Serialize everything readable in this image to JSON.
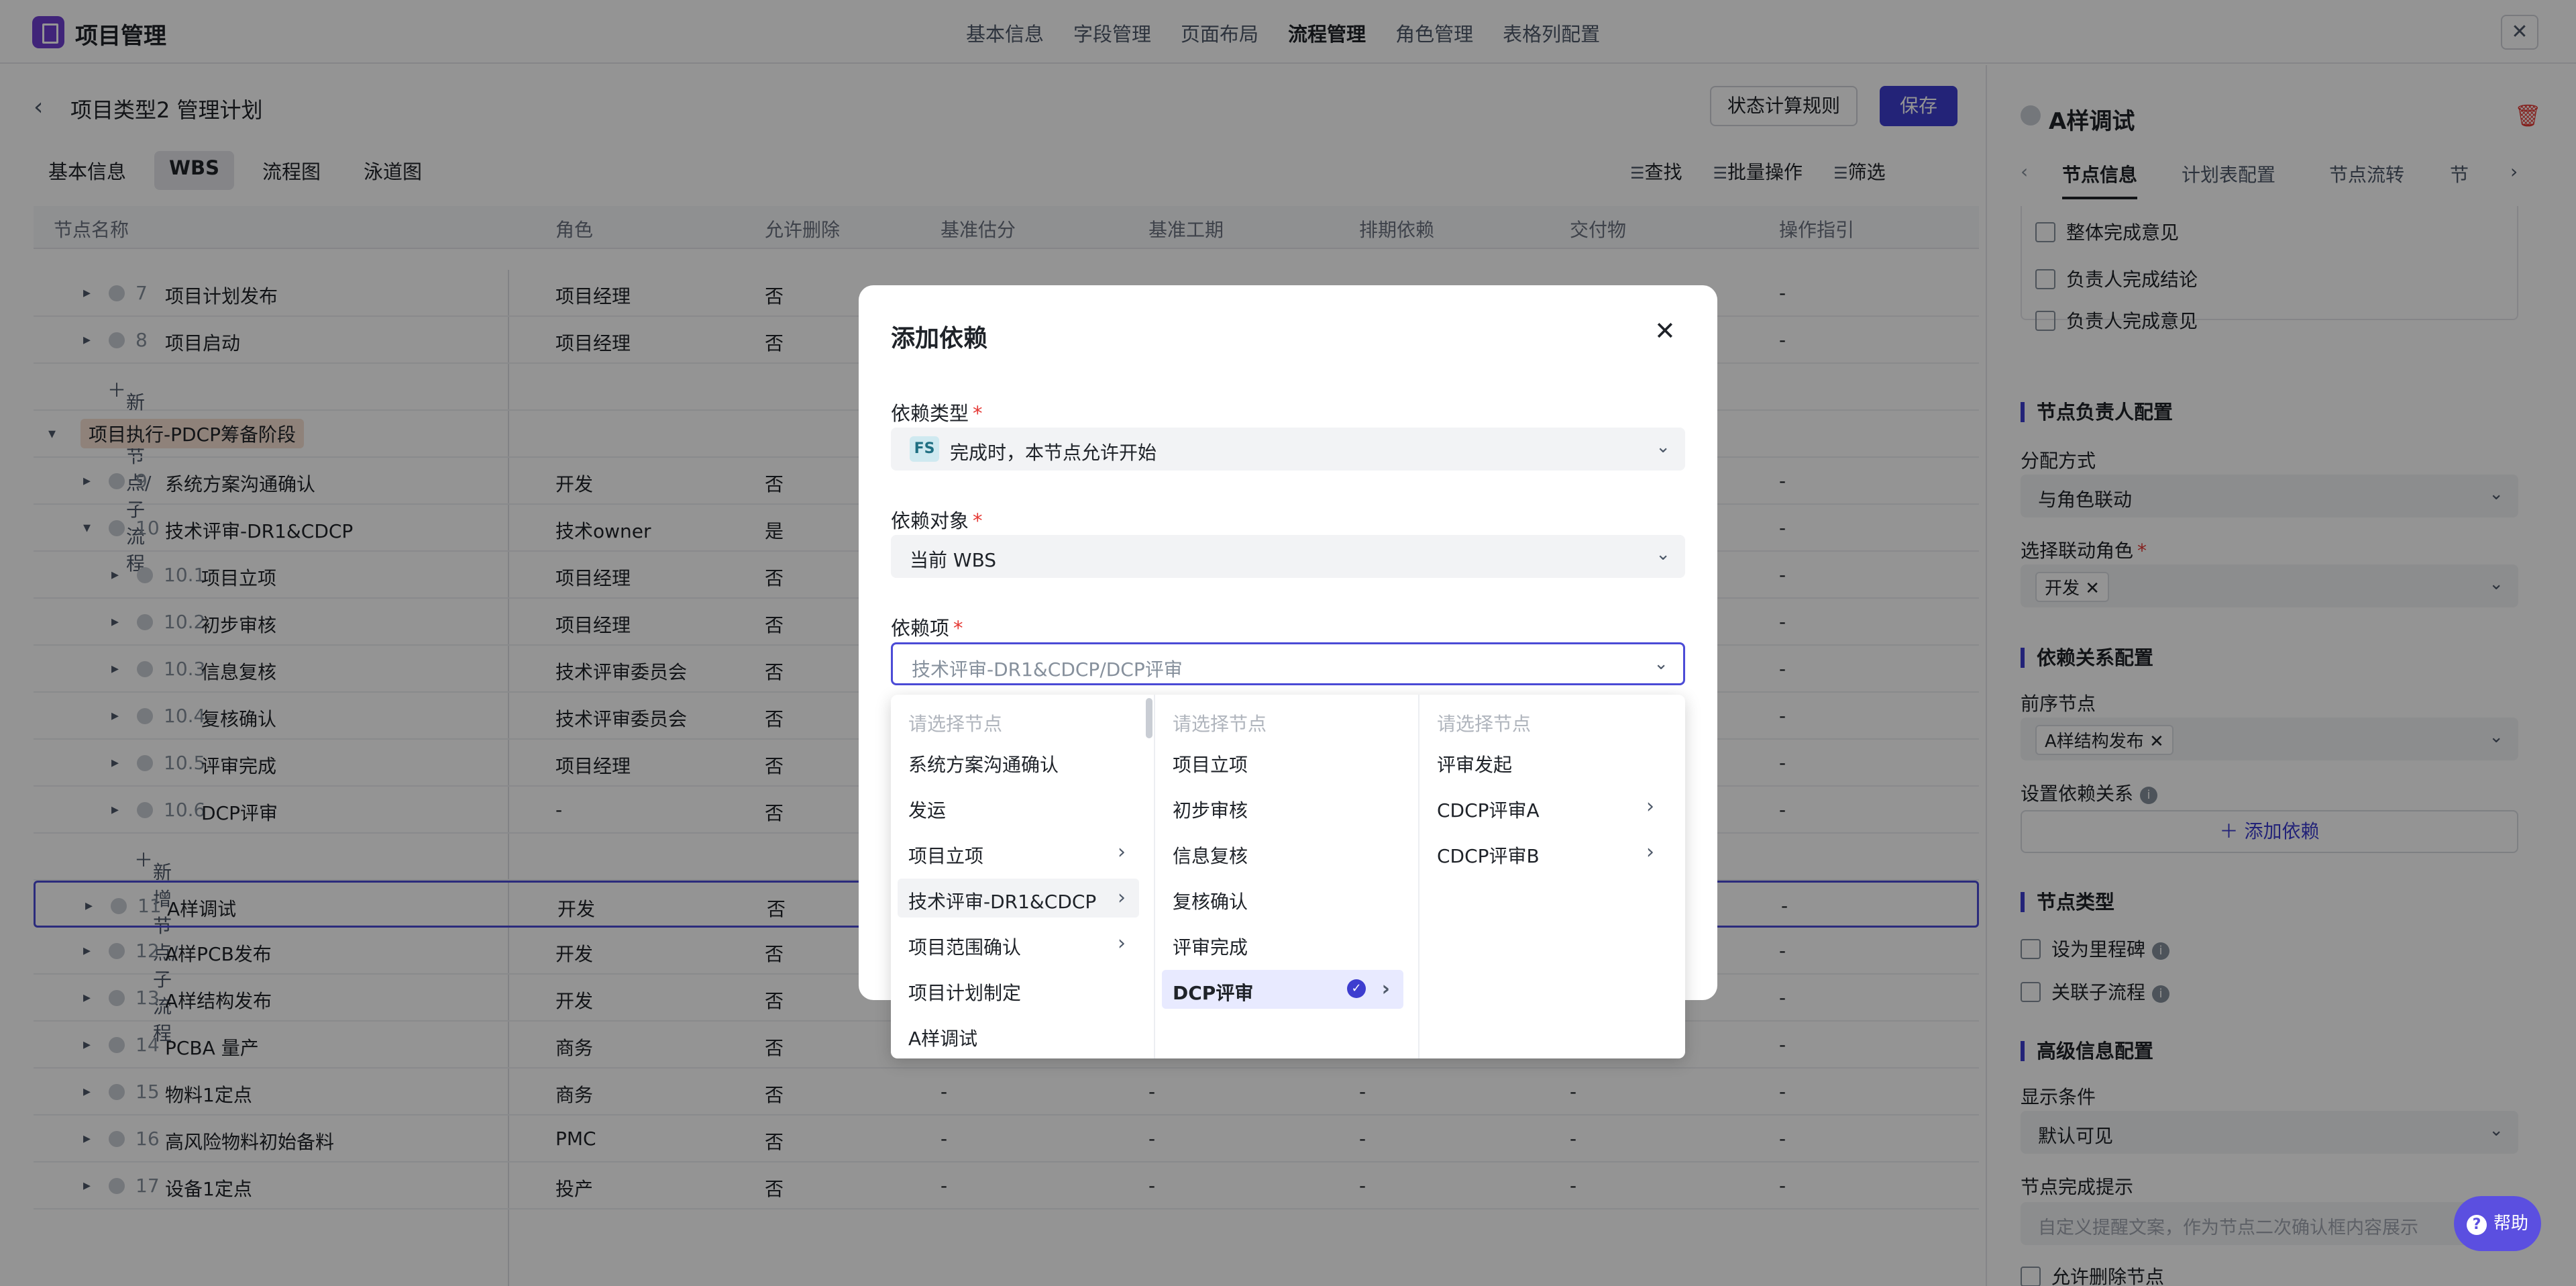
{
  "app": {
    "title": "项目管理",
    "close": "✕"
  },
  "top_nav": [
    "基本信息",
    "字段管理",
    "页面布局",
    "流程管理",
    "角色管理",
    "表格列配置"
  ],
  "main": {
    "back": "‹",
    "title": "项目类型2 管理计划",
    "status_rules_button": "状态计算规则",
    "save_button": "保存",
    "subtabs": [
      "基本信息",
      "WBS",
      "流程图",
      "泳道图"
    ],
    "toolbar": [
      "查找",
      "批量操作",
      "筛选"
    ],
    "columns": [
      "节点名称",
      "角色",
      "允许删除",
      "基准估分",
      "基准工期",
      "排期依赖",
      "交付物",
      "操作指引"
    ],
    "rows": [
      {
        "num": "7",
        "name": "项目计划发布",
        "role": "项目经理",
        "del": "否",
        "rest": "-"
      },
      {
        "num": "8",
        "name": "项目启动",
        "role": "项目经理",
        "del": "否",
        "rest": "-"
      },
      {
        "add": "新增节点/子流程"
      },
      {
        "group": "项目执行-PDCP筹备阶段"
      },
      {
        "num": "9",
        "name": "系统方案沟通确认",
        "role": "开发",
        "del": "否",
        "rest": "-"
      },
      {
        "num": "10",
        "name": "技术评审-DR1&CDCP",
        "role": "技术owner",
        "del": "是",
        "rest": "-"
      },
      {
        "num": "10.1",
        "name": "项目立项",
        "role": "项目经理",
        "del": "否",
        "rest": "-"
      },
      {
        "num": "10.2",
        "name": "初步审核",
        "role": "项目经理",
        "del": "否",
        "rest": "-"
      },
      {
        "num": "10.3",
        "name": "信息复核",
        "role": "技术评审委员会",
        "del": "否",
        "rest": "-"
      },
      {
        "num": "10.4",
        "name": "复核确认",
        "role": "技术评审委员会",
        "del": "否",
        "rest": "-"
      },
      {
        "num": "10.5",
        "name": "评审完成",
        "role": "项目经理",
        "del": "否",
        "rest": "-"
      },
      {
        "num": "10.6",
        "name": "DCP评审",
        "role": "-",
        "del": "否",
        "rest": "-"
      },
      {
        "add": "新增节点/子流程"
      },
      {
        "num": "11",
        "name": "A样调试",
        "role": "开发",
        "del": "否",
        "rest": "-"
      },
      {
        "num": "12",
        "name": "A样PCB发布",
        "role": "开发",
        "del": "否",
        "rest": "-"
      },
      {
        "num": "13",
        "name": "A样结构发布",
        "role": "开发",
        "del": "否",
        "rest": "-"
      },
      {
        "num": "14",
        "name": "PCBA 量产",
        "role": "商务",
        "del": "否",
        "rest": "-"
      },
      {
        "num": "15",
        "name": "物料1定点",
        "role": "商务",
        "del": "否",
        "rest": "-"
      },
      {
        "num": "16",
        "name": "高风险物料初始备料",
        "role": "PMC",
        "del": "否",
        "rest": "-"
      },
      {
        "num": "17",
        "name": "设备1定点",
        "role": "投产",
        "del": "否",
        "rest": "-"
      }
    ]
  },
  "modal": {
    "title": "添加依赖",
    "close": "✕",
    "dep_type_label": "依赖类型",
    "dep_type_tag": "FS",
    "dep_type_value": "完成时，本节点允许开始",
    "dep_target_label": "依赖对象",
    "dep_target_value": "当前 WBS",
    "dep_item_label": "依赖项",
    "dep_item_placeholder": "技术评审-DR1&CDCP/DCP评审",
    "required": "*",
    "chevron": "⌄"
  },
  "cascader": {
    "placeholder": "请选择节点",
    "col1": [
      "系统方案沟通确认",
      "发运",
      "项目立项",
      "技术评审-DR1&CDCP",
      "项目范围确认",
      "项目计划制定",
      "A样调试"
    ],
    "col2": [
      "项目立项",
      "初步审核",
      "信息复核",
      "复核确认",
      "评审完成",
      "DCP评审"
    ],
    "col3": [
      "评审发起",
      "CDCP评审A",
      "CDCP评审B"
    ]
  },
  "panel": {
    "title": "A样调试",
    "tabs": [
      "节点信息",
      "计划表配置",
      "节点流转",
      "节"
    ],
    "box_items": [
      "整体完成意见",
      "负责人完成结论",
      "负责人完成意见"
    ],
    "owner_section": "节点负责人配置",
    "assign_label": "分配方式",
    "assign_value": "与角色联动",
    "role_label": "选择联动角色",
    "role_chip": "开发 ✕",
    "dep_section": "依赖关系配置",
    "pre_label": "前序节点",
    "pre_chip": "A样结构发布 ✕",
    "set_dep_label": "设置依赖关系",
    "add_dep": "添加依赖",
    "type_section": "节点类型",
    "milestone": "设为里程碑",
    "sub_flow": "关联子流程",
    "adv_section": "高级信息配置",
    "display_label": "显示条件",
    "display_value": "默认可见",
    "hint_label": "节点完成提示",
    "hint_placeholder": "自定义提醒文案，作为节点二次确认框内容展示",
    "allow_delete": "允许删除节点",
    "help": "帮助"
  }
}
